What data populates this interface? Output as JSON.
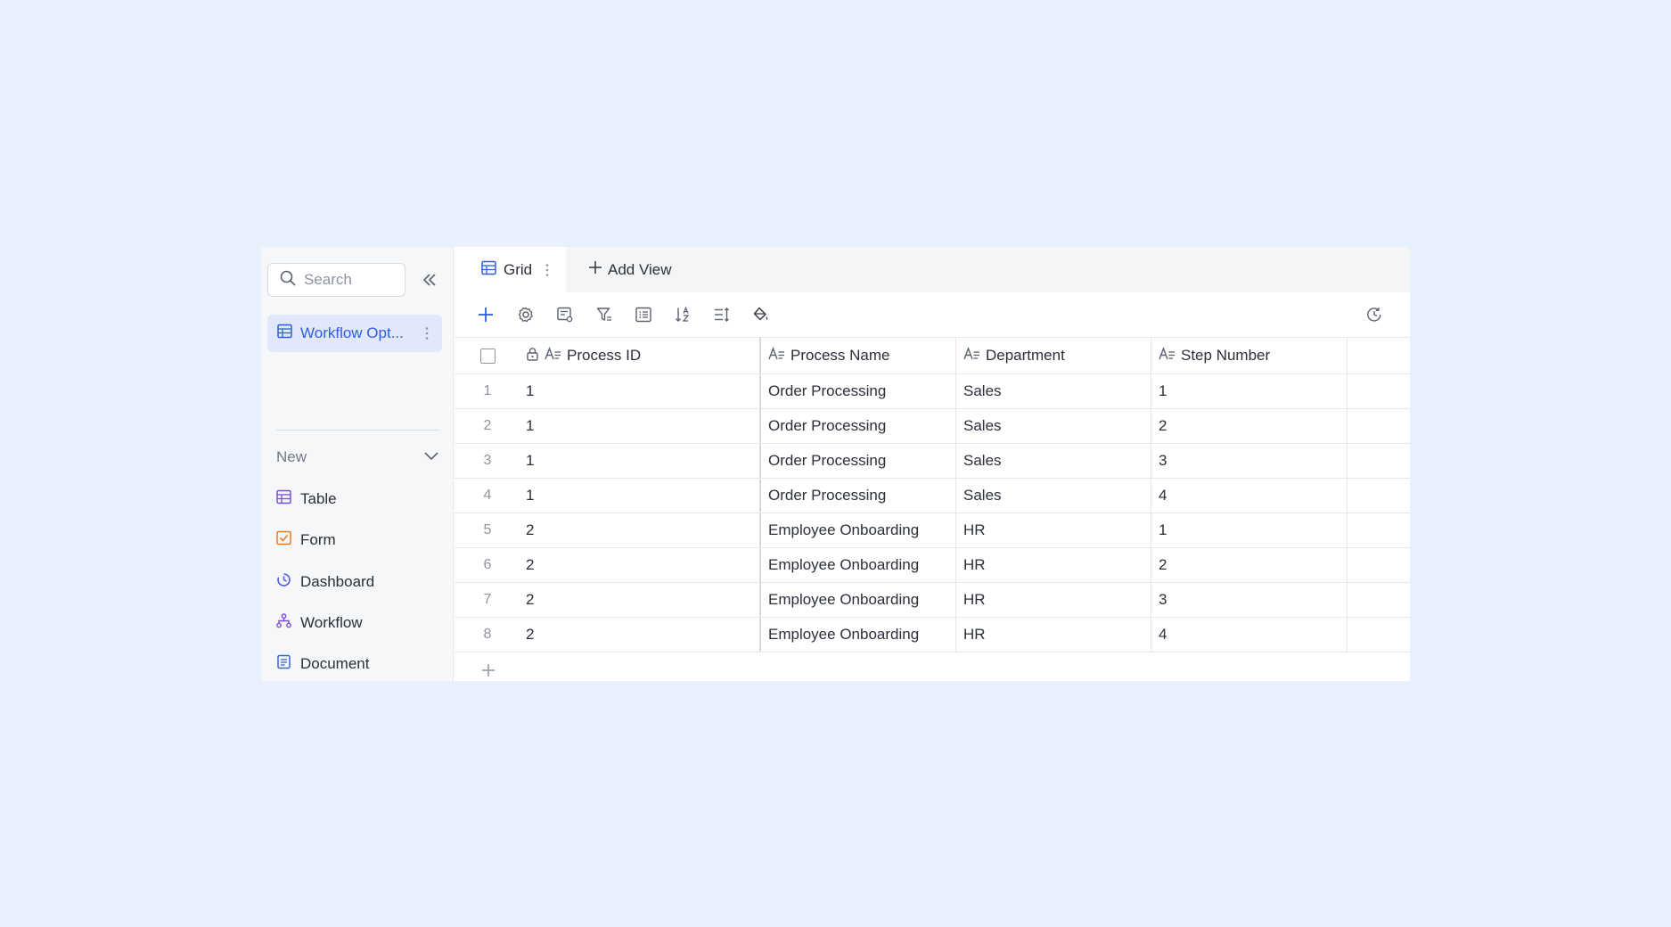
{
  "sidebar": {
    "search_placeholder": "Search",
    "active_table": "Workflow Opt...",
    "new_label": "New",
    "create_items": [
      {
        "label": "Table",
        "icon": "table-icon",
        "color": "#7b4fd6"
      },
      {
        "label": "Form",
        "icon": "form-icon",
        "color": "#f07b1e"
      },
      {
        "label": "Dashboard",
        "icon": "dashboard-icon",
        "color": "#4f5ae0"
      },
      {
        "label": "Workflow",
        "icon": "workflow-icon",
        "color": "#7b4fd6"
      },
      {
        "label": "Document",
        "icon": "document-icon",
        "color": "#3a63e0"
      }
    ]
  },
  "tabs": {
    "grid_label": "Grid",
    "add_view_label": "Add View"
  },
  "grid": {
    "columns": [
      "Process ID",
      "Process Name",
      "Department",
      "Step Number"
    ],
    "rows": [
      {
        "idx": "1",
        "process_id": "1",
        "process_name": "Order Processing",
        "department": "Sales",
        "step": "1"
      },
      {
        "idx": "2",
        "process_id": "1",
        "process_name": "Order Processing",
        "department": "Sales",
        "step": "2"
      },
      {
        "idx": "3",
        "process_id": "1",
        "process_name": "Order Processing",
        "department": "Sales",
        "step": "3"
      },
      {
        "idx": "4",
        "process_id": "1",
        "process_name": "Order Processing",
        "department": "Sales",
        "step": "4"
      },
      {
        "idx": "5",
        "process_id": "2",
        "process_name": "Employee Onboarding",
        "department": "HR",
        "step": "1"
      },
      {
        "idx": "6",
        "process_id": "2",
        "process_name": "Employee Onboarding",
        "department": "HR",
        "step": "2"
      },
      {
        "idx": "7",
        "process_id": "2",
        "process_name": "Employee Onboarding",
        "department": "HR",
        "step": "3"
      },
      {
        "idx": "8",
        "process_id": "2",
        "process_name": "Employee Onboarding",
        "department": "HR",
        "step": "4"
      }
    ]
  },
  "colors": {
    "accent": "#2f5fe0",
    "background": "#e8effd"
  }
}
